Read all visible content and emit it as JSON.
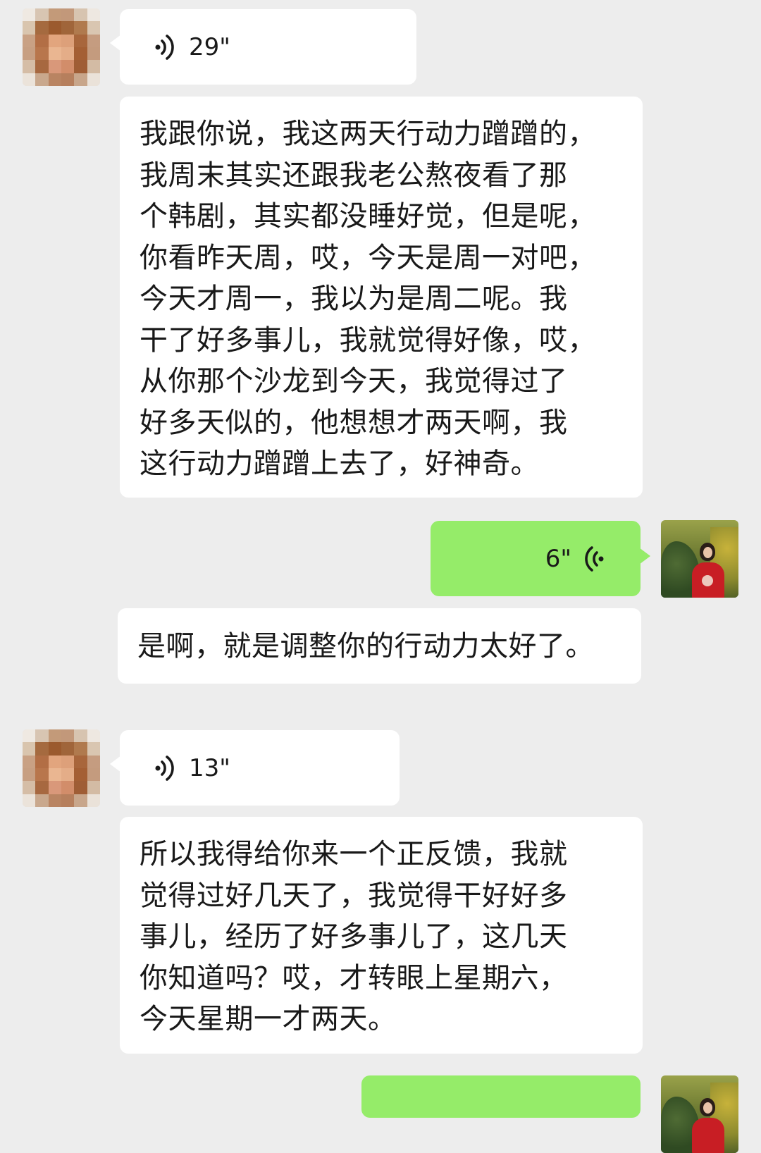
{
  "chat": {
    "messages": [
      {
        "sender": "contact",
        "type": "voice",
        "duration": "29\""
      },
      {
        "sender": "contact",
        "type": "text",
        "text": "我跟你说，我这两天行动力蹭蹭的，\n我周末其实还跟我老公熬夜看了那\n个韩剧，其实都没睡好觉，但是呢，\n你看昨天周，哎，今天是周一对吧，\n今天才周一，我以为是周二呢。我\n干了好多事儿，我就觉得好像，哎，\n从你那个沙龙到今天，我觉得过了\n好多天似的，他想想才两天啊，我\n这行动力蹭蹭上去了，好神奇。"
      },
      {
        "sender": "me",
        "type": "voice",
        "duration": "6\""
      },
      {
        "sender": "me",
        "type": "text",
        "text": "是啊，就是调整你的行动力太好了。"
      },
      {
        "sender": "contact",
        "type": "voice",
        "duration": "13\""
      },
      {
        "sender": "contact",
        "type": "text",
        "text": "所以我得给你来一个正反馈，我就\n觉得过好几天了，我觉得干好好多\n事儿，经历了好多事儿了，这几天\n你知道吗？哎，才转眼上星期六，\n今天星期一才两天。"
      },
      {
        "sender": "me",
        "type": "voice",
        "duration": ""
      }
    ]
  },
  "colors": {
    "background": "#ededed",
    "incoming_bubble": "#ffffff",
    "outgoing_bubble": "#95ec69",
    "text": "#191919"
  },
  "icons": {
    "voice": "sound-wave-icon",
    "contact_avatar": "pixelated-avatar",
    "my_avatar": "photo-avatar"
  }
}
